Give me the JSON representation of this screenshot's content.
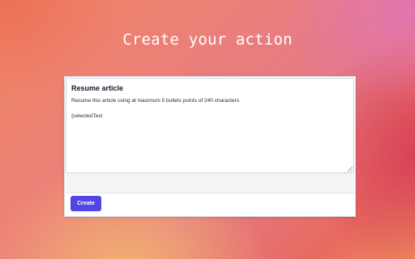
{
  "page": {
    "title": "Create your action"
  },
  "editor": {
    "action_name": "Resume article",
    "prompt_line": "Resume this article using at maximum 5 bullets points of 240 characters",
    "prompt_variable": "{selectedText"
  },
  "actions": {
    "create_label": "Create"
  },
  "colors": {
    "accent": "#4f46e5",
    "title_text": "#ffffff"
  }
}
